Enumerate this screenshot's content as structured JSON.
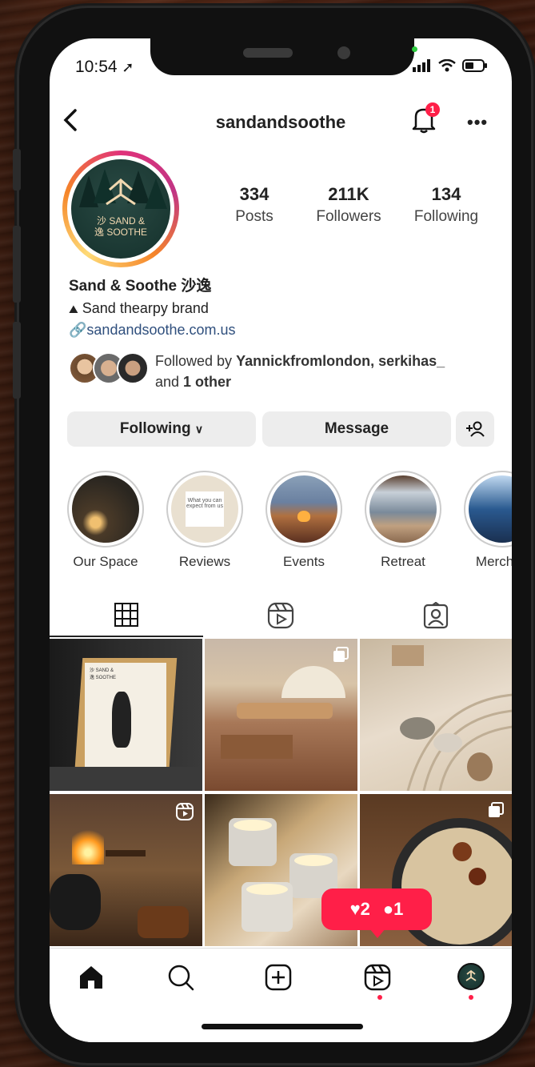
{
  "status": {
    "time": "10:54"
  },
  "profile": {
    "username": "sandandsoothe",
    "notifications": "1",
    "avatar_text": "沙 SAND &\n逸 SOOTHE",
    "stats": [
      {
        "num": "334",
        "label": "Posts"
      },
      {
        "num": "211K",
        "label": "Followers"
      },
      {
        "num": "134",
        "label": "Following"
      }
    ],
    "name": "Sand & Soothe 沙逸",
    "tagline": "Sand thearpy brand",
    "link": "sandandsoothe.com.us",
    "followed_prefix": "Followed by ",
    "followed_names": "Yannickfromlondon, serkihas_",
    "followed_and": "and ",
    "followed_other": "1 other"
  },
  "buttons": {
    "following": "Following",
    "message": "Message"
  },
  "highlights": [
    {
      "label": "Our Space"
    },
    {
      "label": "Reviews",
      "inner_text": "What you can expect from us"
    },
    {
      "label": "Events"
    },
    {
      "label": "Retreat"
    },
    {
      "label": "Merchan"
    }
  ],
  "grid_poster_text": "沙 SAND &\n逸 SOOTHE",
  "activity": {
    "likes": "2",
    "comments": "1"
  },
  "colors": {
    "accent": "#ff1f48",
    "link": "#2f4f7d"
  }
}
